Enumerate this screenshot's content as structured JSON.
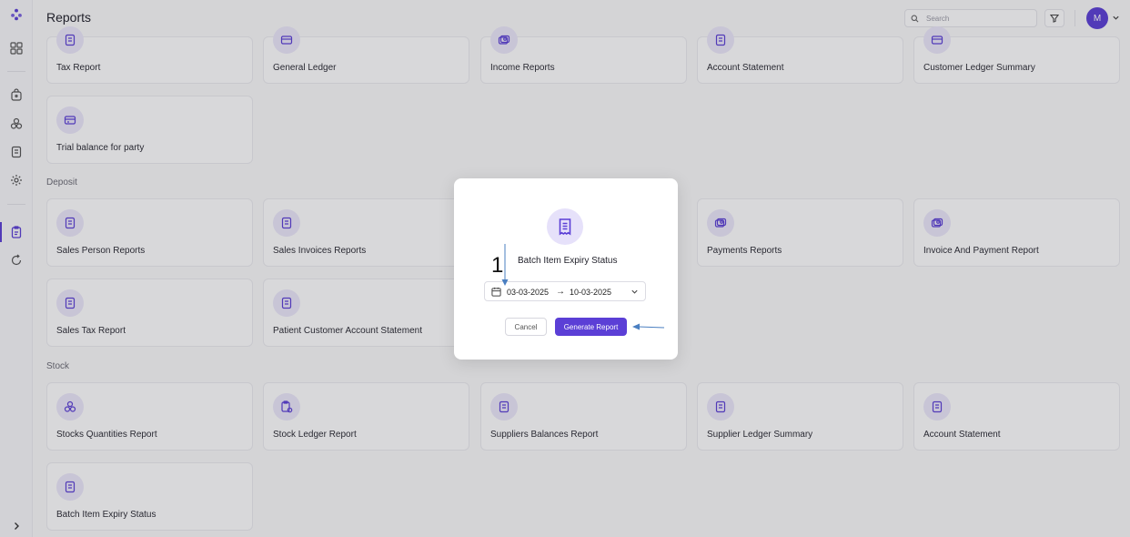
{
  "header": {
    "title": "Reports",
    "search_placeholder": "Search",
    "avatar_initial": "M"
  },
  "sections": {
    "deposit": "Deposit",
    "stock": "Stock"
  },
  "cards": {
    "top": [
      "Tax Report",
      "General Ledger",
      "Income Reports",
      "Account Statement",
      "Customer Ledger Summary"
    ],
    "trial": "Trial balance for party",
    "deposit_row1": [
      "Sales Person Reports",
      "Sales Invoices Reports",
      "Payments Reports",
      "Invoice And Payment Report"
    ],
    "deposit_row2": [
      "Sales Tax Report",
      "Patient Customer Account Statement"
    ],
    "stock_row1": [
      "Stocks Quantities Report",
      "Stock Ledger Report",
      "Suppliers Balances Report",
      "Supplier Ledger Summary",
      "Account Statement"
    ],
    "stock_row2": [
      "Batch Item Expiry Status"
    ]
  },
  "modal": {
    "title": "Batch Item Expiry Status",
    "date_from": "03-03-2025",
    "date_to": "10-03-2025",
    "arrow": "→",
    "cancel_label": "Cancel",
    "generate_label": "Generate Report"
  },
  "annotation": {
    "step_number": "1",
    "color": "#4a7fc1"
  },
  "colors": {
    "accent": "#5b3fd6",
    "accent_light": "#ece8fb"
  }
}
